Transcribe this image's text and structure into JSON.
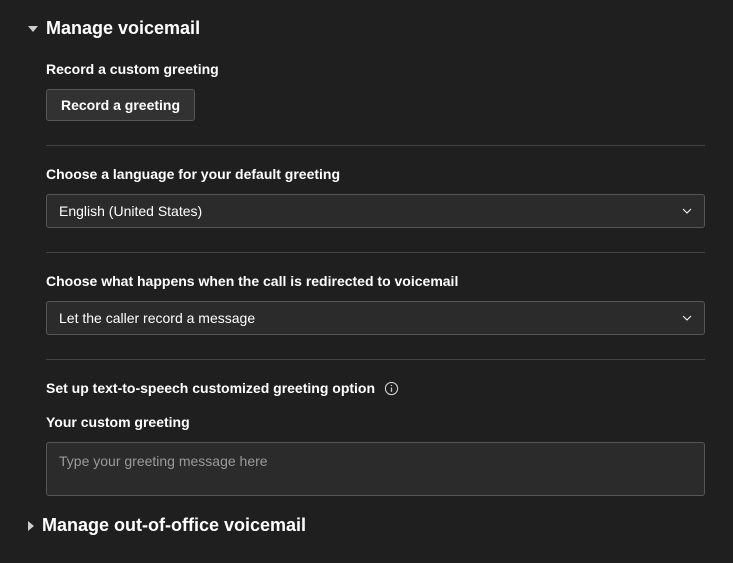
{
  "sections": {
    "voicemail": {
      "title": "Manage voicemail",
      "record": {
        "label": "Record a custom greeting",
        "button": "Record a greeting"
      },
      "language": {
        "label": "Choose a language for your default greeting",
        "value": "English (United States)"
      },
      "redirect": {
        "label": "Choose what happens when the call is redirected to voicemail",
        "value": "Let the caller record a message"
      },
      "tts": {
        "label": "Set up text-to-speech customized greeting option",
        "sublabel": "Your custom greeting",
        "placeholder": "Type your greeting message here"
      }
    },
    "ooo": {
      "title": "Manage out-of-office voicemail"
    }
  }
}
